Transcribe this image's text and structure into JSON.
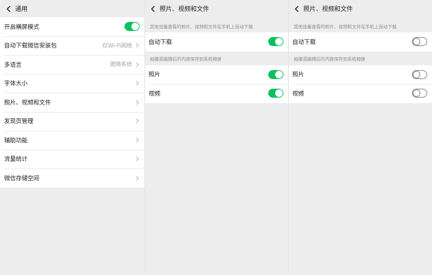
{
  "general": {
    "title": "通用",
    "items": [
      {
        "label": "开启横屏模式",
        "value": "",
        "control": "toggle",
        "on": true
      },
      {
        "label": "自动下载微信安装包",
        "value": "仅Wi-Fi网络",
        "control": "chevron"
      },
      {
        "label": "多语言",
        "value": "跟随系统",
        "control": "chevron"
      },
      {
        "label": "字体大小",
        "value": "",
        "control": "chevron"
      },
      {
        "label": "照片、视频和文件",
        "value": "",
        "control": "chevron"
      },
      {
        "label": "发现页管理",
        "value": "",
        "control": "chevron"
      },
      {
        "label": "辅助功能",
        "value": "",
        "control": "chevron"
      },
      {
        "label": "流量统计",
        "value": "",
        "control": "chevron"
      },
      {
        "label": "微信存储空间",
        "value": "",
        "control": "chevron"
      }
    ]
  },
  "media_on": {
    "title": "照片、视频和文件",
    "note_download": "其他设备查看的照片、视频和文件在手机上自动下载",
    "auto_download_label": "自动下载",
    "auto_download_on": true,
    "note_save": "拍摄或编辑后的内容保存到系统相册",
    "photo_label": "照片",
    "photo_on": true,
    "video_label": "视频",
    "video_on": true
  },
  "media_off": {
    "title": "照片、视频和文件",
    "note_download": "其他设备查看的照片、视频和文件在手机上自动下载",
    "auto_download_label": "自动下载",
    "auto_download_on": false,
    "note_save": "拍摄或编辑后的内容保存到系统相册",
    "photo_label": "照片",
    "photo_on": false,
    "video_label": "视频",
    "video_on": false
  },
  "icons": {
    "back": "back-arrow-icon",
    "chevron": "chevron-right-icon"
  },
  "colors": {
    "toggle_on": "#07c160",
    "background": "#ededed",
    "card": "#ffffff"
  }
}
